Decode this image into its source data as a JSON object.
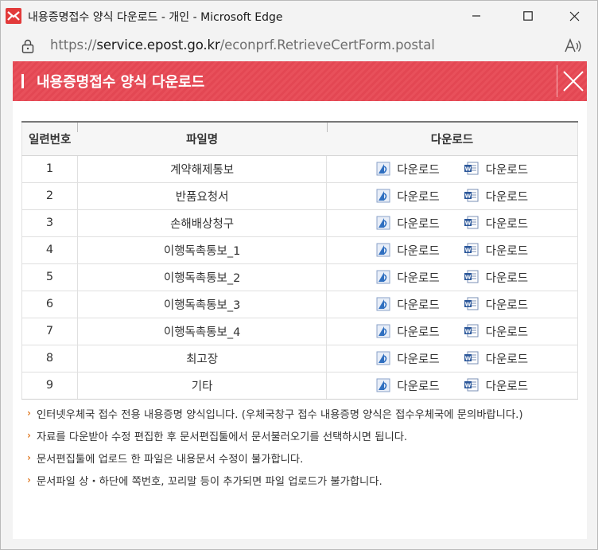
{
  "window": {
    "title": "내용증명접수 양식 다운로드 - 개인 - Microsoft Edge",
    "url_scheme": "https://",
    "url_host": "service.epost.go.kr",
    "url_path": "/econprf.RetrieveCertForm.postal",
    "read_aloud_label": "A)"
  },
  "banner": {
    "title": "내용증명접수 양식 다운로드"
  },
  "table": {
    "headers": [
      "일련번호",
      "파일명",
      "다운로드"
    ],
    "download_label": "다운로드",
    "rows": [
      {
        "no": "1",
        "name": "계약해제통보"
      },
      {
        "no": "2",
        "name": "반품요청서"
      },
      {
        "no": "3",
        "name": "손해배상청구"
      },
      {
        "no": "4",
        "name": "이행독촉통보_1"
      },
      {
        "no": "5",
        "name": "이행독촉통보_2"
      },
      {
        "no": "6",
        "name": "이행독촉통보_3"
      },
      {
        "no": "7",
        "name": "이행독촉통보_4"
      },
      {
        "no": "8",
        "name": "최고장"
      },
      {
        "no": "9",
        "name": "기타"
      }
    ]
  },
  "notes": [
    "인터넷우체국 접수 전용 내용증명 양식입니다. (우체국창구 접수 내용증명 양식은 접수우체국에 문의바랍니다.)",
    "자료를 다운받아 수정 편집한 후 문서편집툴에서 문서불러오기를 선택하시면 됩니다.",
    "문서편집툴에 업로드 한 파일은 내용문서 수정이 불가합니다.",
    "문서파일 상・하단에 쪽번호, 꼬리말 등이 추가되면 파일 업로드가 불가합니다."
  ],
  "colors": {
    "banner": "#e8505b",
    "note_arrow": "#e07d2a",
    "hwp_icon": "#2f6fc0",
    "doc_icon": "#2b579a"
  }
}
